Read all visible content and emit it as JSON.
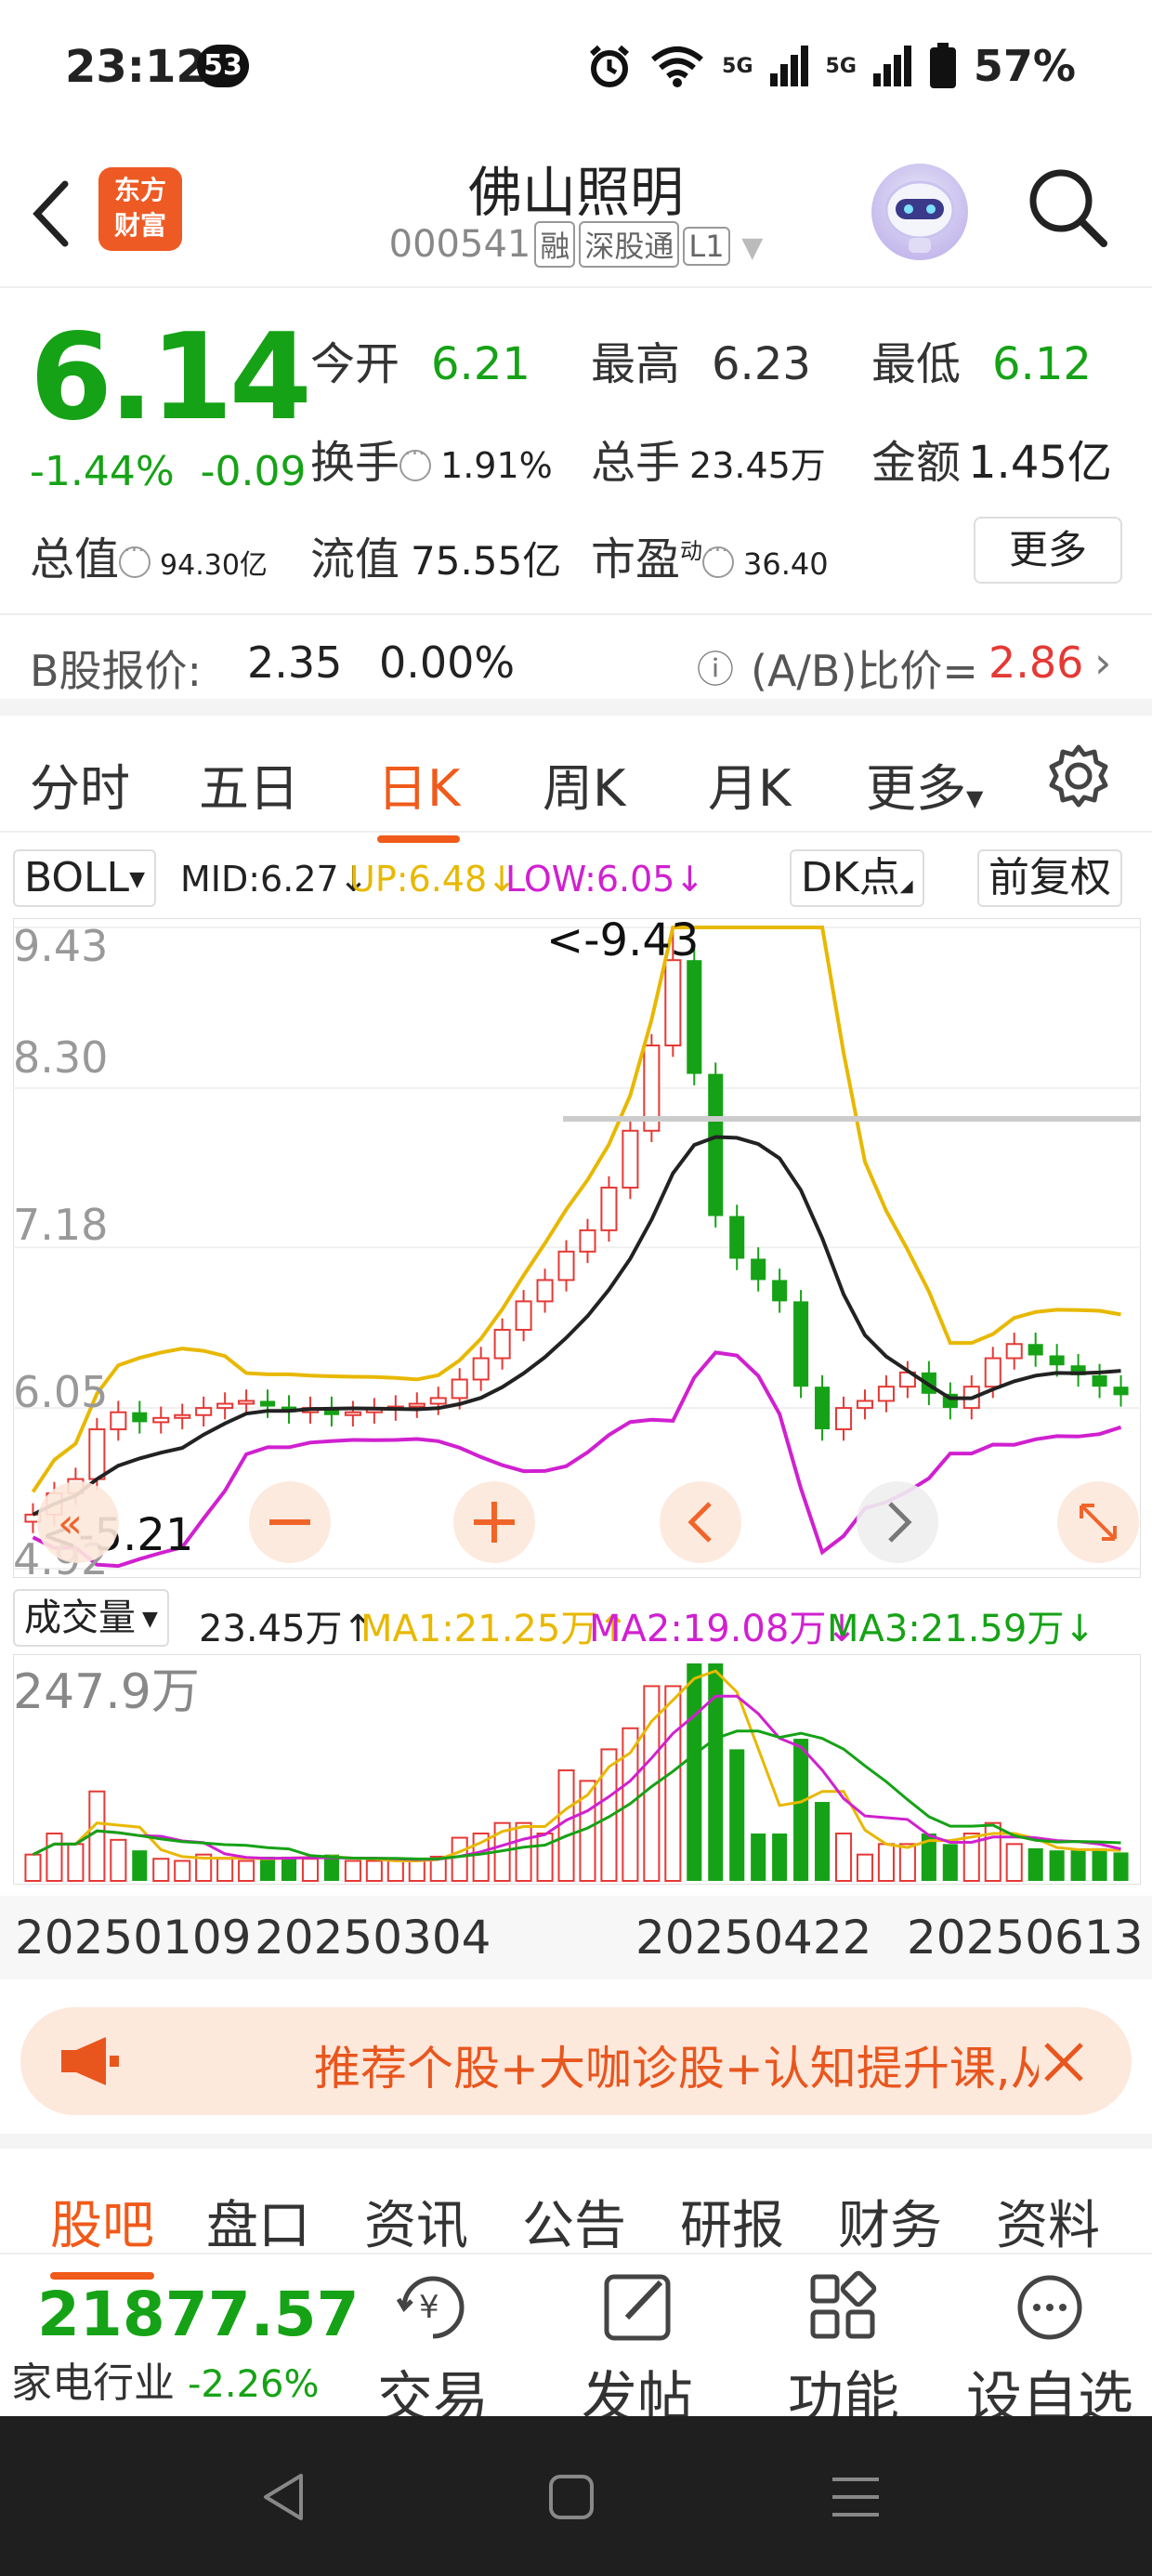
{
  "status": {
    "time": "23:12",
    "badge": "53",
    "net1": "5G",
    "net2": "5G",
    "battery": "57%"
  },
  "header": {
    "name": "佛山照明",
    "code": "000541",
    "tag1": "融",
    "tag2": "深股通",
    "tag3": "L1",
    "logo_line1": "东方",
    "logo_line2": "财富"
  },
  "quote": {
    "price": "6.14",
    "pct": "-1.44%",
    "change": "-0.09",
    "open_label": "今开",
    "open": "6.21",
    "high_label": "最高",
    "high": "6.23",
    "low_label": "最低",
    "low": "6.12",
    "turnover_label": "换手",
    "turnover": "1.91%",
    "volume_label": "总手",
    "volume": "23.45万",
    "amount_label": "金额",
    "amount": "1.45亿",
    "mktcap_label": "总值",
    "mktcap": "94.30亿",
    "float_label": "流值",
    "float": "75.55亿",
    "pe_label": "市盈",
    "pe_sup": "动",
    "pe": "36.40",
    "more": "更多"
  },
  "bshare": {
    "label": "B股报价:",
    "price": "2.35",
    "pct": "0.00%",
    "ratio_label": "(A/B)比价=",
    "ratio": "2.86"
  },
  "ktabs": [
    "分时",
    "五日",
    "日K",
    "周K",
    "月K",
    "更多"
  ],
  "indicator": {
    "name": "BOLL",
    "mid": "MID:6.27↓",
    "up": "UP:6.48↓",
    "low": "LOW:6.05↓",
    "dk": "DK点",
    "adj": "前复权"
  },
  "chart_labels": {
    "y1": "9.43",
    "y2": "8.30",
    "y3": "7.18",
    "y4": "6.05",
    "y5": "4.92",
    "max_mark": "<-9.43",
    "min_mark": "<-5.21"
  },
  "volume_bar": {
    "name": "成交量",
    "vol": "23.45万↑",
    "ma1": "MA1:21.25万↑",
    "ma2": "MA2:19.08万↓",
    "ma3": "MA3:21.59万↓",
    "ymax": "247.9万"
  },
  "dates": [
    "20250109",
    "20250304",
    "20250422",
    "20250613"
  ],
  "promo": {
    "text": "推荐个股+大咖诊股+认知提升课,从"
  },
  "btabs": [
    "股吧",
    "盘口",
    "资讯",
    "公告",
    "研报",
    "财务",
    "资料"
  ],
  "bottombar": {
    "index_value": "21877.57",
    "index_name": "家电行业",
    "index_pct": "-2.26%",
    "trade": "交易",
    "post": "发帖",
    "func": "功能",
    "watch": "设自选"
  },
  "colors": {
    "up": "#e53935",
    "down": "#16a216",
    "accent": "#f05a1a",
    "boll_up": "#e8b800",
    "boll_low": "#d020d0"
  },
  "chart_data": {
    "type": "candlestick",
    "indicator": "BOLL",
    "ylim": [
      4.92,
      9.43
    ],
    "y_ticks": [
      9.43,
      8.3,
      7.18,
      6.05,
      4.92
    ],
    "x_labels": [
      "20250109",
      "20250304",
      "20250422",
      "20250613"
    ],
    "max_price": 9.43,
    "min_price": 5.21,
    "boll_latest": {
      "mid": 6.27,
      "up": 6.48,
      "low": 6.05
    },
    "close_series": [
      5.3,
      5.45,
      5.55,
      5.9,
      6.02,
      5.95,
      5.98,
      6.0,
      6.05,
      6.08,
      6.1,
      6.06,
      6.02,
      6.05,
      6.0,
      6.02,
      6.04,
      6.06,
      6.08,
      6.12,
      6.25,
      6.4,
      6.6,
      6.8,
      6.95,
      7.15,
      7.3,
      7.6,
      8.0,
      8.6,
      9.2,
      8.4,
      7.4,
      7.1,
      6.95,
      6.8,
      6.2,
      5.9,
      6.05,
      6.1,
      6.2,
      6.3,
      6.15,
      6.05,
      6.2,
      6.4,
      6.5,
      6.42,
      6.35,
      6.28,
      6.2,
      6.14
    ],
    "volume": {
      "unit": "万",
      "ymax": 247.9,
      "latest": 23.45,
      "ma1": 21.25,
      "ma2": 19.08,
      "ma3": 21.59
    }
  }
}
